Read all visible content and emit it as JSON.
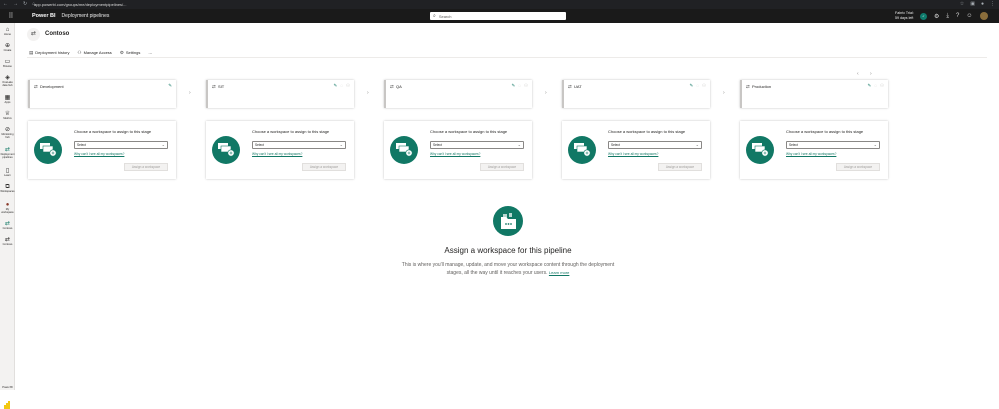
{
  "browser": {
    "nav_icons": [
      "back-icon",
      "forward-icon",
      "reload-icon",
      "home-icon"
    ],
    "url": "app.powerbi.com/groups/me/deploymentpipelines/...",
    "right_icons": [
      "star-icon",
      "extensions-icon",
      "profile-icon",
      "menu-icon"
    ]
  },
  "app": {
    "name": "Power BI",
    "section": "Deployment pipelines",
    "search_placeholder": "Search",
    "trial_line1": "Fabric Trial:",
    "trial_line2": "59 days left"
  },
  "leftnav": {
    "items": [
      {
        "label": "Home",
        "icon": "home-icon"
      },
      {
        "label": "Create",
        "icon": "create-icon"
      },
      {
        "label": "Browse",
        "icon": "browse-icon"
      },
      {
        "label": "OneLake data hub",
        "icon": "datahub-icon"
      },
      {
        "label": "Apps",
        "icon": "apps-icon"
      },
      {
        "label": "Metrics",
        "icon": "metrics-icon"
      },
      {
        "label": "Monitoring hub",
        "icon": "monitoring-icon"
      },
      {
        "label": "Deployment pipelines",
        "icon": "pipelines-icon"
      },
      {
        "label": "Learn",
        "icon": "learn-icon"
      },
      {
        "label": "Workspaces",
        "icon": "workspaces-icon"
      },
      {
        "label": "My workspace",
        "icon": "my-workspace-icon"
      },
      {
        "label": "Contoso",
        "icon": "pipeline-icon"
      },
      {
        "label": "Contoso",
        "icon": "pipeline-icon"
      }
    ],
    "footer_label": "Power BI"
  },
  "pipeline": {
    "title": "Contoso",
    "commands": [
      {
        "label": "Deployment history",
        "icon": "history-icon"
      },
      {
        "label": "Manage Access",
        "icon": "people-icon"
      },
      {
        "label": "Settings",
        "icon": "gear-icon"
      }
    ],
    "more": "···"
  },
  "stages": [
    {
      "name": "Development"
    },
    {
      "name": "SIT"
    },
    {
      "name": "QA"
    },
    {
      "name": "UAT"
    },
    {
      "name": "Production"
    }
  ],
  "assign_card": {
    "prompt": "Choose a workspace to assign to this stage",
    "select_value": "Select",
    "why_link": "Why can't I see all my workspaces?",
    "button_label": "Assign a workspace"
  },
  "empty_state": {
    "title": "Assign a workspace for this pipeline",
    "text": "This is where you'll manage, update, and move your workspace content through the deployment stages, all the way until it reaches your users.",
    "learn_more": "Learn more"
  }
}
